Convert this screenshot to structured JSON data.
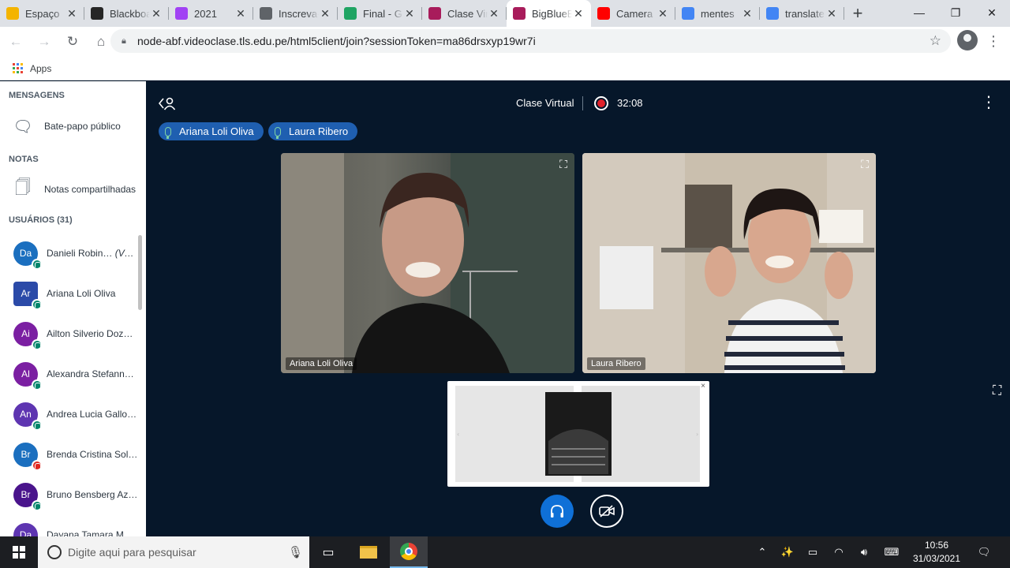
{
  "browser": {
    "tabs": [
      {
        "title": "Espaço",
        "favicon": "espaco-favicon",
        "color": "#f4b400"
      },
      {
        "title": "Blackboard",
        "favicon": "blackboard-favicon",
        "color": "#262626"
      },
      {
        "title": "2021",
        "favicon": "recording-tab-favicon",
        "color": "#a142f4"
      },
      {
        "title": "Inscreva-se",
        "favicon": "inscreva-favicon",
        "color": "#5f6368"
      },
      {
        "title": "Final - Google Drive",
        "favicon": "drive-favicon",
        "color": "#1fa463"
      },
      {
        "title": "Clase Virtual",
        "favicon": "tls-favicon",
        "color": "#a81c5b"
      },
      {
        "title": "BigBlueButton",
        "favicon": "tls-favicon",
        "color": "#a81c5b"
      },
      {
        "title": "Camera",
        "favicon": "youtube-favicon",
        "color": "#ff0000"
      },
      {
        "title": "mentes",
        "favicon": "google-favicon",
        "color": "#4285f4"
      },
      {
        "title": "translate",
        "favicon": "google-favicon",
        "color": "#4285f4"
      }
    ],
    "url": "node-abf.videoclase.tls.edu.pe/html5client/join?sessionToken=ma86drsxyp19wr7i",
    "bookmark_apps": "Apps"
  },
  "sidebar": {
    "messages_heading": "MENSAGENS",
    "public_chat": "Bate-papo público",
    "notes_heading": "NOTAS",
    "shared_notes": "Notas compartilhadas",
    "users_heading": "USUÁRIOS (31)",
    "users": [
      {
        "initials": "Da",
        "name": "Danieli Robin…",
        "you": "(Você)",
        "color": "#1b6fbf",
        "audio": "listen"
      },
      {
        "initials": "Ar",
        "name": "Ariana Loli Oliva",
        "you": "",
        "color": "#2b4aa8",
        "audio": "mic",
        "moderator": true
      },
      {
        "initials": "Ai",
        "name": "Ailton Silverio Doza …",
        "you": "",
        "color": "#7b1fa2",
        "audio": "listen"
      },
      {
        "initials": "Al",
        "name": "Alexandra Stefanny …",
        "you": "",
        "color": "#7b1fa2",
        "audio": "listen"
      },
      {
        "initials": "An",
        "name": "Andrea Lucia Gallo …",
        "you": "",
        "color": "#5e35b1",
        "audio": "listen"
      },
      {
        "initials": "Br",
        "name": "Brenda Cristina Soli…",
        "you": "",
        "color": "#1b6fbf",
        "audio": "muted"
      },
      {
        "initials": "Br",
        "name": "Bruno Bensberg Az…",
        "you": "",
        "color": "#4a148c",
        "audio": "listen"
      },
      {
        "initials": "Da",
        "name": "Dayana Tamara Ma…",
        "you": "",
        "color": "#5e35b1",
        "audio": "listen"
      }
    ]
  },
  "meeting": {
    "title": "Clase Virtual",
    "recording_time": "32:08",
    "talkers": [
      "Ariana Loli Oliva",
      "Laura Ribero"
    ],
    "videos": [
      {
        "name": "Ariana Loli Oliva"
      },
      {
        "name": "Laura Ribero"
      }
    ],
    "close_glyph": "×"
  },
  "taskbar": {
    "search_placeholder": "Digite aqui para pesquisar",
    "time": "10:56",
    "date": "31/03/2021"
  }
}
